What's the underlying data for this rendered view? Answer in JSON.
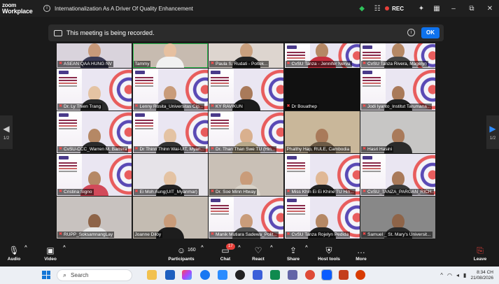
{
  "app": {
    "logo_line1": "zoom",
    "logo_line2": "Workplace",
    "title": "Internationalization As A Driver Of Quality Enhancement",
    "rec_label": "REC"
  },
  "banner": {
    "text": "This meeting is being recorded.",
    "ok_label": "OK"
  },
  "pager": {
    "left_page": "1/2",
    "right_page": "1/2"
  },
  "tiles": [
    {
      "name": "ASEAN QAA HUNG NV",
      "bg": "#d9d3dc",
      "skin": "#c89a7a",
      "shirt": "#3a3a55",
      "slide": false,
      "active": false,
      "muted": true
    },
    {
      "name": "Tammy",
      "bg": "#c7bbb0",
      "skin": "#e6c0a0",
      "shirt": "#f1f1f1",
      "slide": false,
      "active": true,
      "muted": false
    },
    {
      "name": "Paula S. Rudati - Poltek...",
      "bg": "#ddd5cf",
      "skin": "#c9a07e",
      "shirt": "#222",
      "slide": false,
      "active": false,
      "muted": true
    },
    {
      "name": "CvSU Tanza - Jennifer Nerva",
      "bg": "#e3dce2",
      "skin": "#b58865",
      "shirt": "#c83040",
      "slide": true,
      "active": false,
      "muted": true
    },
    {
      "name": "CvSU Tanza Rivera, Magelyn",
      "bg": "#ebe7ee",
      "skin": "#b58865",
      "shirt": "#444",
      "slide": true,
      "active": false,
      "muted": true
    },
    {
      "name": "Dr. Ly Thien Trang",
      "bg": "#ece9ef",
      "skin": "#e4c3a3",
      "shirt": "#2a2a2a",
      "slide": true,
      "active": false,
      "muted": true
    },
    {
      "name": "Lenny Rosita_Universitas Cip...",
      "bg": "#ece9ef",
      "skin": "#c99c7a",
      "shirt": "#333",
      "slide": true,
      "active": false,
      "muted": true
    },
    {
      "name": "KY RAVIKUN",
      "bg": "#f4f1e6",
      "skin": "#a97a5a",
      "shirt": "#1b1b1b",
      "slide": true,
      "active": false,
      "muted": true
    },
    {
      "name": "Dr Bouathep",
      "bg": "#111111",
      "skin": "#111111",
      "shirt": "#111111",
      "slide": false,
      "active": false,
      "muted": true
    },
    {
      "name": "Jodi Iyanto_Institut Tarumana...",
      "bg": "#ece9ef",
      "skin": "#a97a5a",
      "shirt": "#222",
      "slide": true,
      "active": false,
      "muted": true
    },
    {
      "name": "CvSU-CCC_Warren M. Barrera",
      "bg": "#ebe7ee",
      "skin": "#b58865",
      "shirt": "#2b2b2b",
      "slide": true,
      "active": false,
      "muted": true
    },
    {
      "name": "Dr Thinn Thinn Wai-UIT, Myan...",
      "bg": "#ece9ef",
      "skin": "#e4c3a3",
      "shirt": "#333",
      "slide": true,
      "active": false,
      "muted": true
    },
    {
      "name": "Dr. Than Than Swe TU (Hin...",
      "bg": "#ece9ef",
      "skin": "#d9b08e",
      "shirt": "#b9a98a",
      "slide": true,
      "active": false,
      "muted": true
    },
    {
      "name": "Phalthy Hap, RULE, Cambodia",
      "bg": "#c9b79a",
      "skin": "#a97a5a",
      "shirt": "#6c5a45",
      "slide": false,
      "active": false,
      "muted": false
    },
    {
      "name": "Hasri Hasini",
      "bg": "#c7c6c5",
      "skin": "#a97a5a",
      "shirt": "#2a2a2a",
      "slide": false,
      "active": false,
      "muted": true
    },
    {
      "name": "Cristina Signo",
      "bg": "#ebe7ee",
      "skin": "#b58865",
      "shirt": "#d24a5a",
      "slide": true,
      "active": false,
      "muted": true
    },
    {
      "name": "Ei Moh Aung(UIT_Myanmar)",
      "bg": "#e6e3e8",
      "skin": "#e4c3a3",
      "shirt": "#222",
      "slide": false,
      "active": false,
      "muted": true
    },
    {
      "name": "Dr. Soe Minn Htway",
      "bg": "#c9c0b6",
      "skin": "#c99c7a",
      "shirt": "#d8d2c8",
      "slide": false,
      "active": false,
      "muted": true
    },
    {
      "name": "Miss Khin Ei Ei Khine TU Hin...",
      "bg": "#ece9ef",
      "skin": "#e0b896",
      "shirt": "#222",
      "slide": true,
      "active": false,
      "muted": true
    },
    {
      "name": "CvSU_TANZA_PARGAN_RICH...",
      "bg": "#ece9ef",
      "skin": "#a97a5a",
      "shirt": "#3a3a3a",
      "slide": true,
      "active": false,
      "muted": true
    },
    {
      "name": "RUPP_SoksamnangLay",
      "bg": "#c8c2bf",
      "skin": "#8e6448",
      "shirt": "#e8e8e8",
      "slide": false,
      "active": false,
      "muted": true
    },
    {
      "name": "Joanne Diloy",
      "bg": "#c4bcb2",
      "skin": "#c99c7a",
      "shirt": "#1d1d1d",
      "slide": false,
      "active": false,
      "muted": false
    },
    {
      "name": "Manik Mutiara Sadewa_Polit...",
      "bg": "#dfe4ee",
      "skin": "#c99c7a",
      "shirt": "#555",
      "slide": true,
      "active": false,
      "muted": true
    },
    {
      "name": "CvSU Tanza Rojelyn Pedida",
      "bg": "#ece9ef",
      "skin": "#b58865",
      "shirt": "#222",
      "slide": true,
      "active": false,
      "muted": true
    },
    {
      "name": "Samuel _ St. Mary's Universit...",
      "bg": "#888888",
      "skin": "#8e6448",
      "shirt": "#2a2a2a",
      "slide": false,
      "active": false,
      "muted": true
    }
  ],
  "toolbar": {
    "audio": "Audio",
    "video": "Video",
    "participants": "Participants",
    "participant_count": "160",
    "chat": "Chat",
    "chat_badge": "17",
    "react": "React",
    "share": "Share",
    "host_tools": "Host tools",
    "more": "More",
    "leave": "Leave"
  },
  "taskbar": {
    "search_placeholder": "Search",
    "time": "8:34 CH",
    "date": "21/08/2026"
  },
  "colors": {
    "accent": "#0e72ed",
    "rec_red": "#e8403a",
    "active_speaker": "#35c759"
  }
}
